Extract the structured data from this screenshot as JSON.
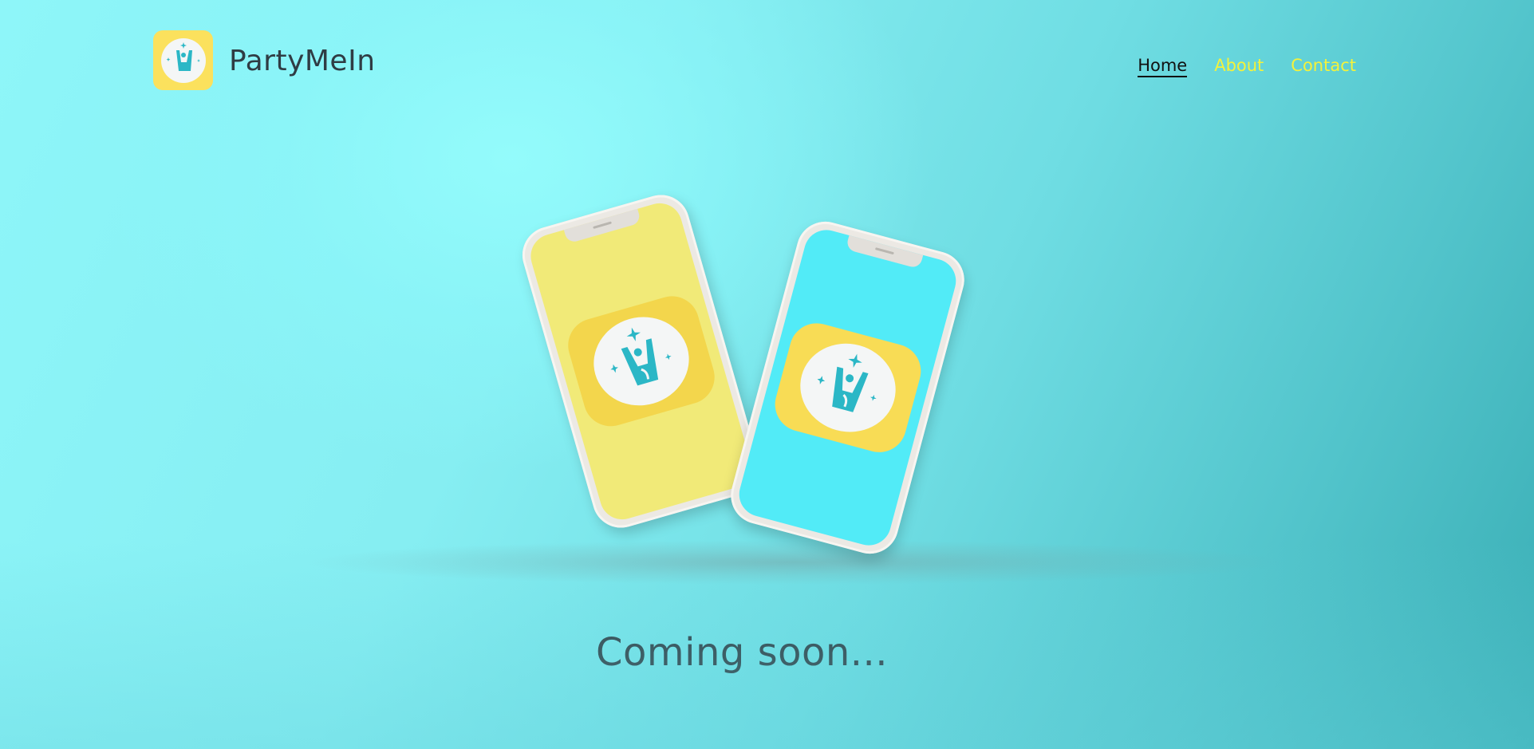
{
  "header": {
    "brand_name": "PartyMeIn",
    "logo_icon": "rock-hand-icon"
  },
  "nav": {
    "items": [
      {
        "label": "Home",
        "active": true
      },
      {
        "label": "About",
        "active": false
      },
      {
        "label": "Contact",
        "active": false
      }
    ]
  },
  "hero": {
    "tagline": "Coming soon...",
    "phones": [
      {
        "screen_color": "#f1ea78",
        "app_icon": "rock-hand-icon"
      },
      {
        "screen_color": "#52ebf7",
        "app_icon": "rock-hand-icon"
      }
    ]
  },
  "colors": {
    "logo_background": "#fbe15d",
    "nav_active": "#111111",
    "nav_link": "#f4f23b",
    "icon_teal": "#2bb7c6",
    "text_dark": "#2f3c44"
  }
}
